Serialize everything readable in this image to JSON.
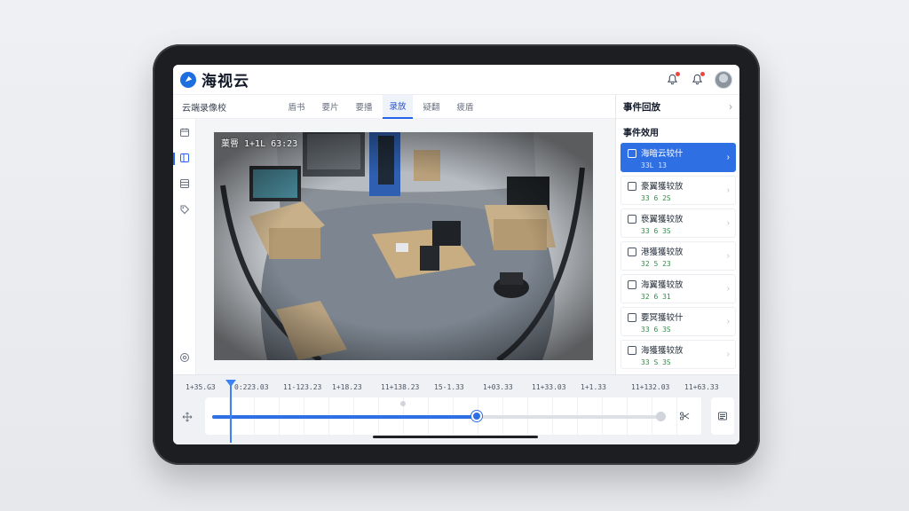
{
  "app": {
    "title": "海视云",
    "logo_icon": "cloud-play-icon"
  },
  "topbar": {
    "icons": [
      "bell-icon",
      "bell-icon",
      "avatar"
    ],
    "notification_color": "#ef4444"
  },
  "subnav": {
    "title": "云端录像校",
    "tabs": [
      {
        "label": "盾书",
        "active": false
      },
      {
        "label": "要片",
        "active": false
      },
      {
        "label": "要播",
        "active": false
      },
      {
        "label": "录放",
        "active": true
      },
      {
        "label": "疑翻",
        "active": false
      },
      {
        "label": "疲盾",
        "active": false
      }
    ]
  },
  "leftbar": {
    "icons": [
      "calendar-icon",
      "panel-icon",
      "grid-icon",
      "tag-icon",
      "settings-icon"
    ],
    "active_index": 1
  },
  "video": {
    "timestamp": "菓罾 1+1L 63:23"
  },
  "panel": {
    "title": "事件回放",
    "subtitle": "事件效用",
    "events": [
      {
        "name": "海暗云较什",
        "time": "33L 13",
        "active": true
      },
      {
        "name": "豪翼獲较放",
        "time": "33 6 2S",
        "active": false
      },
      {
        "name": "亵翼獲较放",
        "time": "33 6 3S",
        "active": false
      },
      {
        "name": "港獲獲较放",
        "time": "32 5 23",
        "active": false
      },
      {
        "name": "海翼獲较放",
        "time": "32 6 31",
        "active": false
      },
      {
        "name": "要冥獲较什",
        "time": "33 6 3S",
        "active": false
      },
      {
        "name": "海獲獲较放",
        "time": "33 S 3S",
        "active": false
      }
    ]
  },
  "timeline": {
    "ticks": [
      "1+35.G3",
      "0:223.03",
      "11-123.23",
      "1+18.23",
      "11+138.23",
      "15-1.33",
      "1+03.33",
      "11+33.03",
      "1+1.33",
      "11+132.03",
      "11+63.33"
    ],
    "progress_fraction": 0.59,
    "accent": "#2f6fe4"
  }
}
